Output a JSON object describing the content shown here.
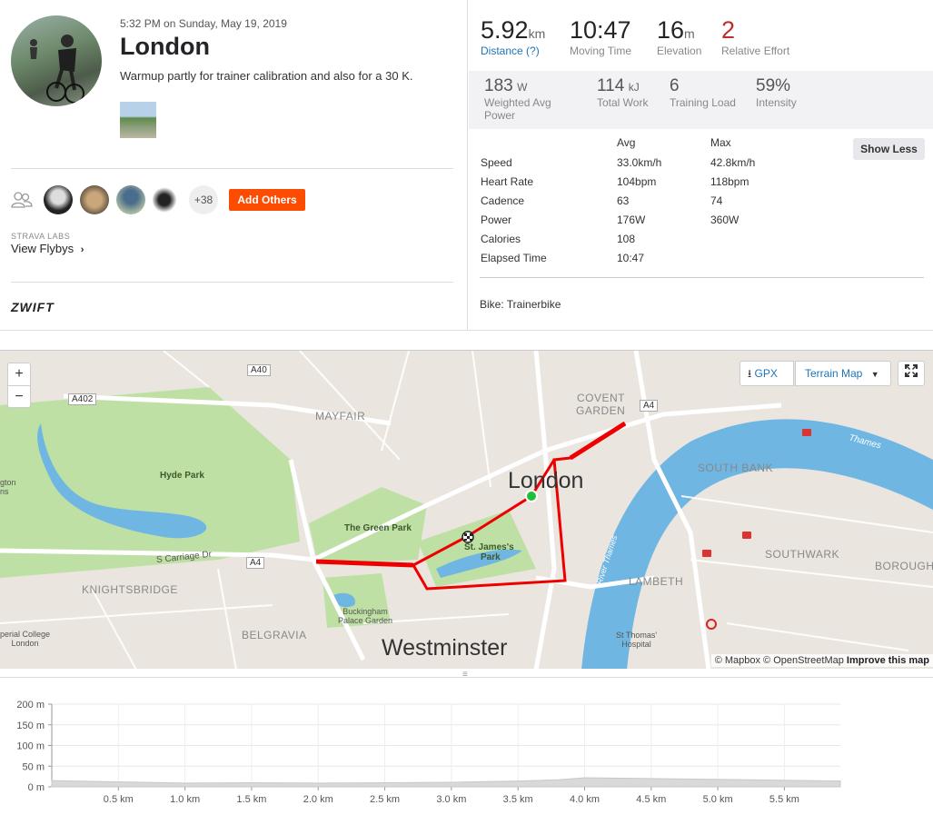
{
  "activity": {
    "date": "5:32 PM on Sunday, May 19, 2019",
    "title": "London",
    "description": "Warmup partly for trainer calibration and also for a 30 K."
  },
  "group": {
    "more_count": "+38",
    "add_others_label": "Add Others"
  },
  "labs": {
    "label": "STRAVA LABS",
    "flybys": "View Flybys"
  },
  "device": "ZWIFT",
  "stats": {
    "distance": {
      "value": "5.92",
      "unit": "km",
      "label": "Distance (?)"
    },
    "moving_time": {
      "value": "10:47",
      "label": "Moving Time"
    },
    "elevation": {
      "value": "16",
      "unit": "m",
      "label": "Elevation"
    },
    "relative_effort": {
      "value": "2",
      "label": "Relative Effort"
    }
  },
  "secondary": {
    "power": {
      "value": "183",
      "unit": "W",
      "label1": "Weighted Avg",
      "label2": "Power"
    },
    "work": {
      "value": "114",
      "unit": "kJ",
      "label": "Total Work"
    },
    "load": {
      "value": "6",
      "label": "Training Load"
    },
    "intensity": {
      "value": "59%",
      "label": "Intensity"
    }
  },
  "table": {
    "header_avg": "Avg",
    "header_max": "Max",
    "show_less": "Show Less",
    "rows": [
      {
        "label": "Speed",
        "avg": "33.0km/h",
        "max": "42.8km/h"
      },
      {
        "label": "Heart Rate",
        "avg": "104bpm",
        "max": "118bpm"
      },
      {
        "label": "Cadence",
        "avg": "63",
        "max": "74"
      },
      {
        "label": "Power",
        "avg": "176W",
        "max": "360W"
      },
      {
        "label": "Calories",
        "avg": "108",
        "max": ""
      },
      {
        "label": "Elapsed Time",
        "avg": "10:47",
        "max": ""
      }
    ],
    "bike": "Bike: Trainerbike"
  },
  "map": {
    "zoom_in": "+",
    "zoom_out": "−",
    "gpx": "GPX",
    "terrain": "Terrain Map",
    "attribution_mapbox": "© Mapbox © OpenStreetMap",
    "attribution_improve": "Improve this map",
    "labels": {
      "a40": "A40",
      "a402": "A402",
      "a4_left": "A4",
      "a4_right": "A4",
      "mayfair": "MAYFAIR",
      "covent": "COVENT",
      "garden": "GARDEN",
      "hyde_park": "Hyde Park",
      "green_park": "The Green Park",
      "st_james1": "St. James's",
      "st_james2": "Park",
      "london": "London",
      "south_bank": "SOUTH BANK",
      "southwark": "SOUTHWARK",
      "borough": "BOROUGH",
      "lambeth": "LAMBETH",
      "knightsbridge": "KNIGHTSBRIDGE",
      "belgravia": "BELGRAVIA",
      "westminster": "Westminster",
      "carriage": "S Carriage Dr",
      "thames": "Thames",
      "river_thames": "River Thames",
      "bp1": "Buckingham",
      "bp2": "Palace Garden",
      "stt1": "St Thomas'",
      "stt2": "Hospital",
      "icl1": "perial College",
      "icl2": "London",
      "gton": "gton",
      "ns": "ns"
    }
  },
  "elevation_chart": {
    "y_ticks": [
      "200 m",
      "150 m",
      "100 m",
      "50 m",
      "0 m"
    ],
    "x_ticks": [
      "0.5 km",
      "1.0 km",
      "1.5 km",
      "2.0 km",
      "2.5 km",
      "3.0 km",
      "3.5 km",
      "4.0 km",
      "4.5 km",
      "5.0 km",
      "5.5 km"
    ]
  },
  "chart_data": {
    "type": "area",
    "title": "",
    "xlabel": "",
    "ylabel": "",
    "x": [
      0,
      0.5,
      1.0,
      1.5,
      2.0,
      2.5,
      3.0,
      3.5,
      3.8,
      4.0,
      4.5,
      5.0,
      5.5,
      5.92
    ],
    "values": [
      15,
      12,
      9,
      10,
      9,
      10,
      11,
      14,
      17,
      22,
      20,
      18,
      16,
      14
    ],
    "ylim": [
      0,
      200
    ],
    "xlim": [
      0,
      5.92
    ],
    "grid": true
  }
}
